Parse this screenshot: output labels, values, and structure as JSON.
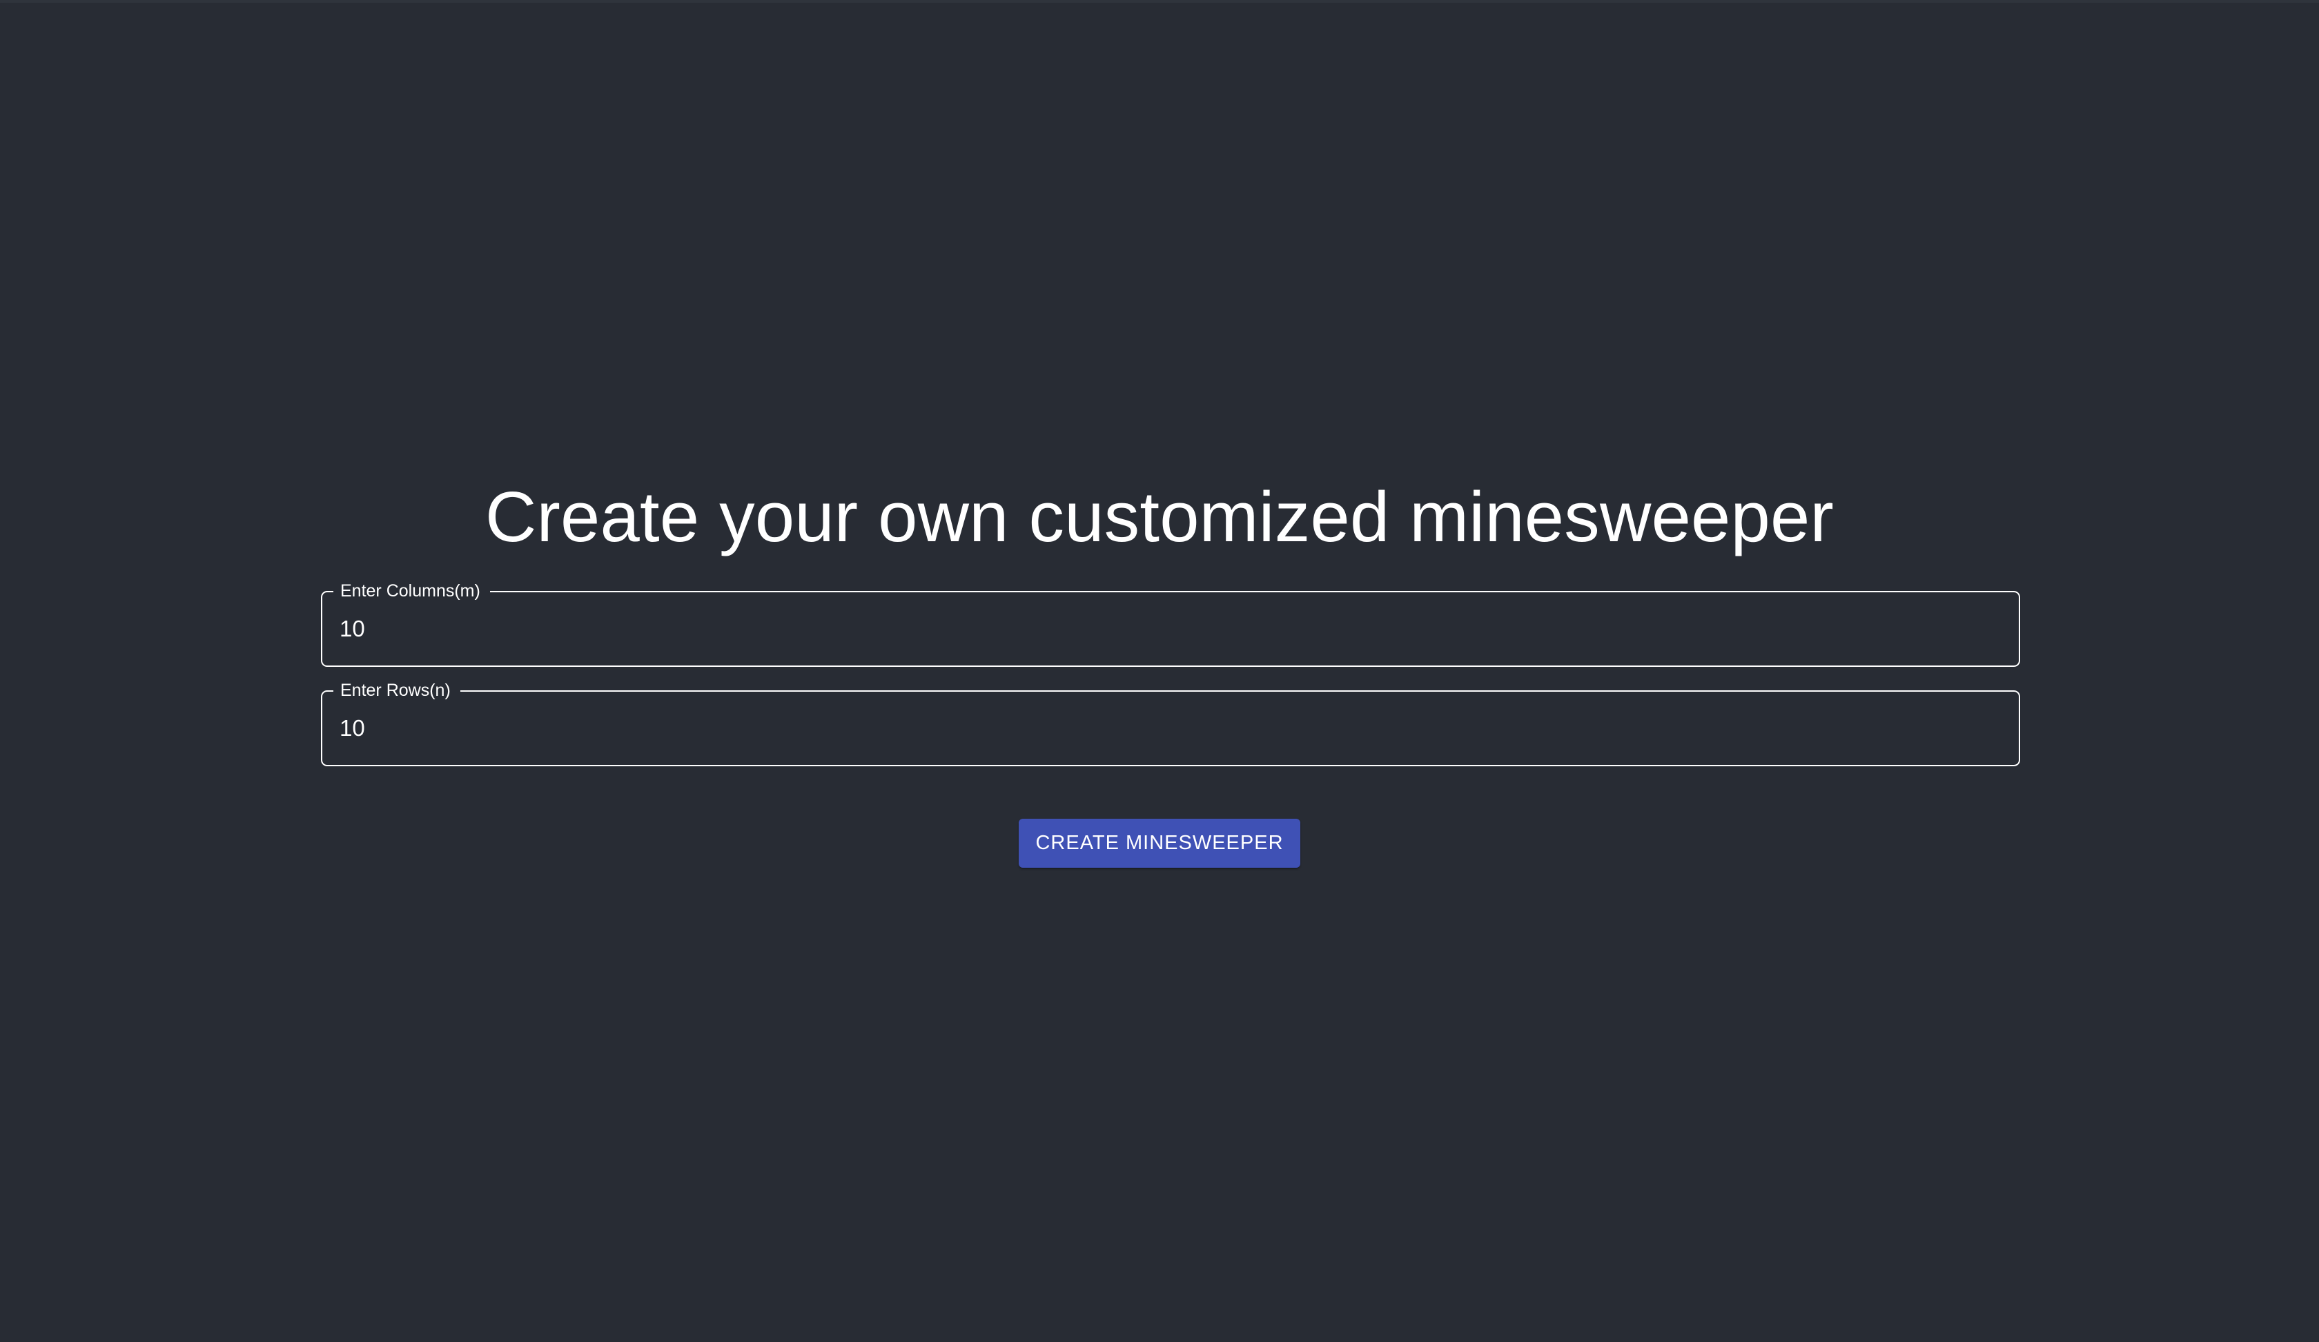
{
  "page": {
    "title": "Create your own customized minesweeper"
  },
  "form": {
    "columns": {
      "label": "Enter Columns(m)",
      "value": "10"
    },
    "rows": {
      "label": "Enter Rows(n)",
      "value": "10"
    },
    "submit_label": "CREATE MINESWEEPER"
  },
  "colors": {
    "background": "#282c34",
    "text": "#ffffff",
    "button": "#3f51b5"
  }
}
